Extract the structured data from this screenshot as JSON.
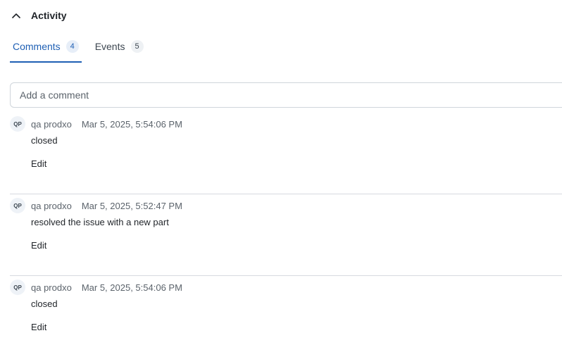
{
  "activity": {
    "title": "Activity",
    "collapse_icon": "chevron-up-icon"
  },
  "tabs": [
    {
      "label": "Comments",
      "count": "4",
      "active": true
    },
    {
      "label": "Events",
      "count": "5",
      "active": false
    }
  ],
  "comment_input": {
    "placeholder": "Add a comment",
    "value": ""
  },
  "comments": [
    {
      "initials": "QP",
      "author": "qa prodxo",
      "timestamp": "Mar 5, 2025, 5:54:06 PM",
      "body": "closed",
      "edit_label": "Edit"
    },
    {
      "initials": "QP",
      "author": "qa prodxo",
      "timestamp": "Mar 5, 2025, 5:52:47 PM",
      "body": "resolved the issue with a new part",
      "edit_label": "Edit"
    },
    {
      "initials": "QP",
      "author": "qa prodxo",
      "timestamp": "Mar 5, 2025, 5:54:06 PM",
      "body": "closed",
      "edit_label": "Edit"
    }
  ],
  "colors": {
    "accent": "#1e5fb4",
    "divider": "#d6dadf",
    "muted_text": "#5b636b"
  }
}
